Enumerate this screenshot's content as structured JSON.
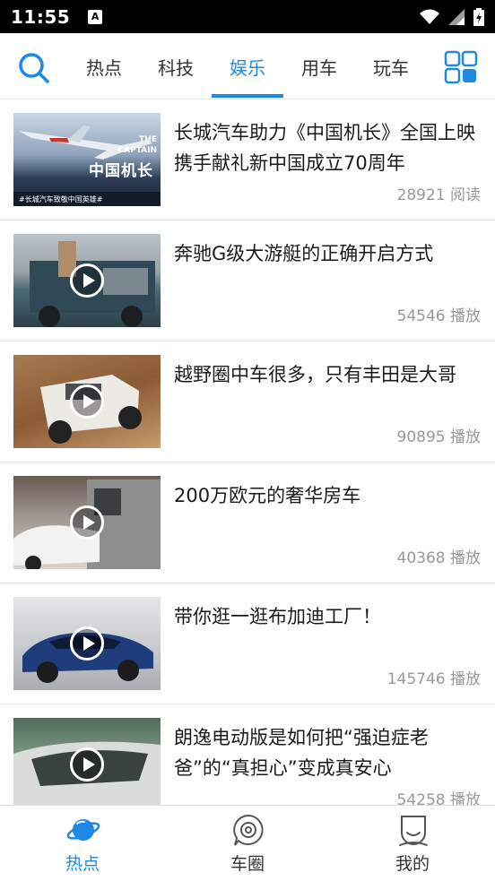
{
  "status_bar": {
    "time": "11:55",
    "notification_badge": "A"
  },
  "top_tabs": {
    "items": [
      {
        "label": "热点"
      },
      {
        "label": "科技"
      },
      {
        "label": "娱乐"
      },
      {
        "label": "用车"
      },
      {
        "label": "玩车"
      }
    ],
    "active": "娱乐"
  },
  "news": [
    {
      "title": "长城汽车助力《中国机长》全国上映 携手献礼新中国成立70周年",
      "meta": "28921 阅读",
      "video": false,
      "thumb_text": {
        "caption": "THE CAPTAIN",
        "big": "中国机长",
        "footer": "#长城汽车致敬中国英雄#"
      }
    },
    {
      "title": "奔驰G级大游艇的正确开启方式",
      "meta": "54546 播放",
      "video": true
    },
    {
      "title": "越野圈中车很多，只有丰田是大哥",
      "meta": "90895 播放",
      "video": true
    },
    {
      "title": "200万欧元的奢华房车",
      "meta": "40368 播放",
      "video": true
    },
    {
      "title": "带你逛一逛布加迪工厂！",
      "meta": "145746 播放",
      "video": true
    },
    {
      "title": "朗逸电动版是如何把“强迫症老爸”的“真担心”变成真安心",
      "meta": "54258 播放",
      "video": true
    }
  ],
  "bottom_nav": {
    "items": [
      {
        "label": "热点"
      },
      {
        "label": "车圈"
      },
      {
        "label": "我的"
      }
    ],
    "active": "热点"
  },
  "colors": {
    "accent": "#1e88e5",
    "divider": "#e8e8e8",
    "meta": "#999999"
  }
}
